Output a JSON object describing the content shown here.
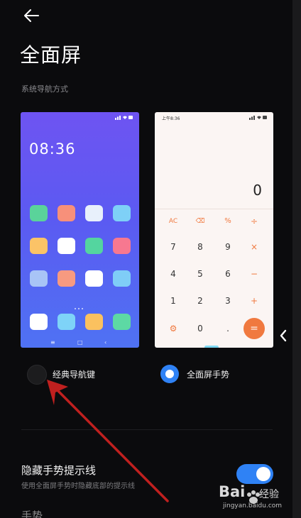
{
  "page": {
    "title": "全面屏",
    "subtitle": "系统导航方式",
    "back_icon": "arrow-left-icon"
  },
  "preview_classic": {
    "clock": "08:36",
    "nav_icons": [
      "≡",
      "□",
      "‹"
    ]
  },
  "preview_gesture": {
    "status_time": "上午8:36",
    "display": "0",
    "keys": [
      [
        "AC",
        "⌫",
        "%",
        "÷"
      ],
      [
        "7",
        "8",
        "9",
        "×"
      ],
      [
        "4",
        "5",
        "6",
        "−"
      ],
      [
        "1",
        "2",
        "3",
        "+"
      ],
      [
        "⚙",
        "0",
        ".",
        "="
      ]
    ]
  },
  "options": {
    "classic_label": "经典导航键",
    "gesture_label": "全面屏手势",
    "selected": "gesture"
  },
  "settings": {
    "hide_hint_title": "隐藏手势提示线",
    "hide_hint_sub": "使用全面屏手势时隐藏底部的提示线",
    "hide_hint_on": true,
    "next_row_title": "手势…"
  },
  "watermark": {
    "brand": "Bai",
    "brand_cn": "经验",
    "url": "jingyan.baidu.com"
  },
  "colors": {
    "accent": "#2f82f5",
    "calc_orange": "#f0793f",
    "background": "#0b0b0d"
  }
}
